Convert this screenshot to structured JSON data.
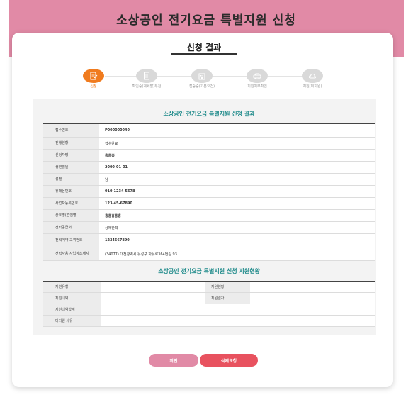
{
  "header": {
    "title": "소상공인 전기요금 특별지원 신청"
  },
  "result": {
    "title": "신청 결과"
  },
  "steps": [
    {
      "label": "신청",
      "icon": "document-edit-icon",
      "active": true
    },
    {
      "label": "확인증(계세발)부천",
      "icon": "document-icon",
      "active": false
    },
    {
      "label": "접증증(기본요건)",
      "icon": "building-icon",
      "active": false
    },
    {
      "label": "지원여부확인",
      "icon": "car-icon",
      "active": false
    },
    {
      "label": "지원(미지원)",
      "icon": "cloud-icon",
      "active": false
    }
  ],
  "section1": {
    "title": "소상공인 전기요금 특별지원 신청 결과",
    "rows": [
      {
        "label": "접수번호",
        "value": "P000000040"
      },
      {
        "label": "진행현황",
        "value": "접수완료"
      },
      {
        "label": "신청자명",
        "value": "홍홍홍"
      },
      {
        "label": "생년월일",
        "value": "2000-01-01"
      },
      {
        "label": "성별",
        "value": "남"
      },
      {
        "label": "휴대폰번호",
        "value": "010-1234-5678"
      },
      {
        "label": "사업자등록번호",
        "value": "123-45-67890"
      },
      {
        "label": "상호명(법인명)",
        "value": "홍홍홍홍홍"
      },
      {
        "label": "전력공급처",
        "value": "상에한력"
      },
      {
        "label": "전력계약 고객번호",
        "value": "1234567890"
      },
      {
        "label": "전력사용 사업장소재지",
        "value": "(34077) 대전광역시 유성구 자유로364번길 93"
      }
    ]
  },
  "section2": {
    "title": "소상공인 전기요금 특별지원 신청 지원현황",
    "rows": [
      {
        "label": "지원유형",
        "label2": "지원현황"
      },
      {
        "label": "지원내역",
        "label2": "지원일자"
      },
      {
        "label": "지원내역합계"
      },
      {
        "label": "미지원 사유"
      }
    ]
  },
  "buttons": {
    "confirm": "확인",
    "cancel": "삭제요청"
  },
  "colors": {
    "header": "#e18aa6",
    "active_step": "#f07b1e",
    "cancel": "#e8525f",
    "section_title": "#1e8a8a"
  }
}
